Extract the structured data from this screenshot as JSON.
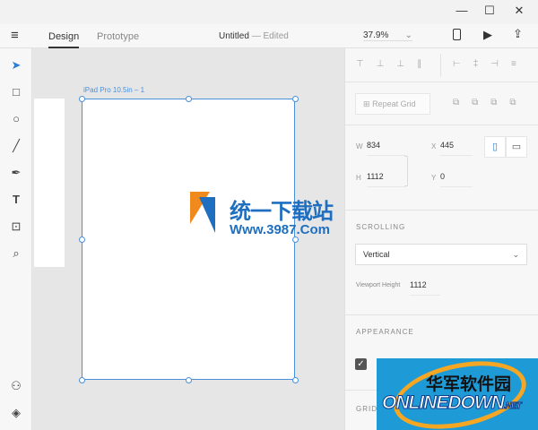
{
  "window": {
    "minimize": "—",
    "maximize": "☐",
    "close": "✕"
  },
  "toolbar": {
    "menu_icon": "hamburger-icon",
    "tabs": [
      {
        "label": "Design",
        "active": true
      },
      {
        "label": "Prototype",
        "active": false
      }
    ],
    "doc_title": "Untitled",
    "doc_sep": "—",
    "doc_status": "Edited",
    "zoom": "37.9%"
  },
  "tools": [
    "select-icon",
    "rectangle-icon",
    "ellipse-icon",
    "line-icon",
    "pen-icon",
    "text-icon",
    "artboard-icon",
    "zoom-icon",
    "assets-icon",
    "layers-icon"
  ],
  "canvas": {
    "artboard_label": "iPad Pro 10.5in – 1"
  },
  "panel": {
    "repeat_grid": "Repeat Grid",
    "w_label": "W",
    "w": "834",
    "x_label": "X",
    "x": "445",
    "h_label": "H",
    "h": "1112",
    "y_label": "Y",
    "y": "0",
    "scrolling_title": "SCROLLING",
    "scrolling_value": "Vertical",
    "viewport_label": "Viewport Height",
    "viewport_value": "1112",
    "appearance_title": "APPEARANCE",
    "appearance_checked": true,
    "grid_title": "GRID"
  },
  "watermarks": {
    "top": "统一下载站 Www.3987.Com",
    "bottom": "华军软件园 ONLINEDOWN.NET"
  },
  "colors": {
    "accent": "#4a90d9",
    "watermark_blue": "#1e9ad6"
  }
}
